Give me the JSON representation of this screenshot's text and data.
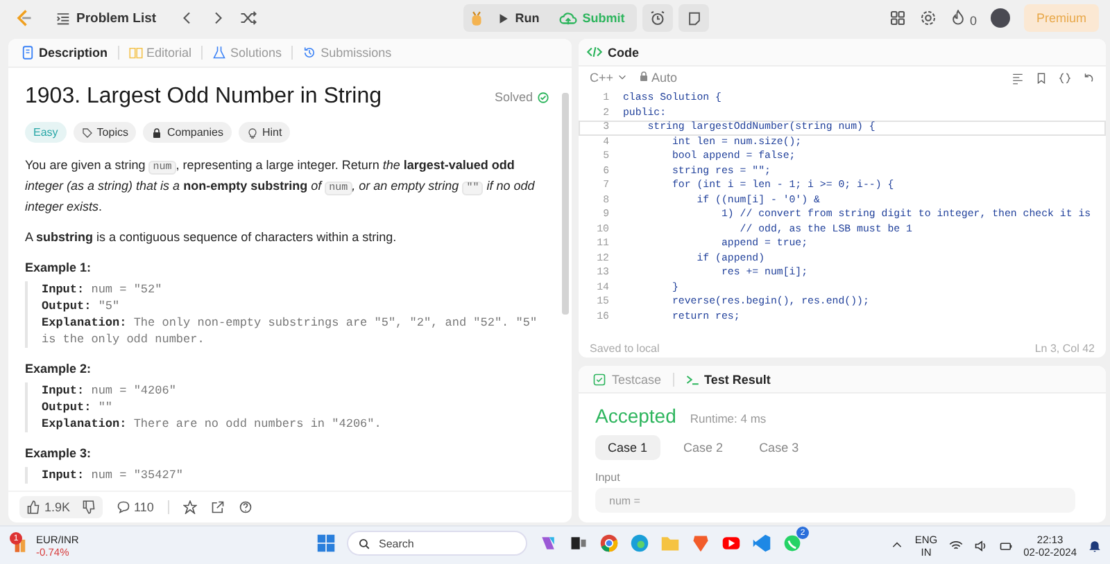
{
  "nav": {
    "problem_list": "Problem List",
    "run": "Run",
    "submit": "Submit",
    "streak": "0",
    "premium": "Premium"
  },
  "description_panel": {
    "tabs": [
      {
        "label": "Description",
        "selected": true
      },
      {
        "label": "Editorial",
        "selected": false
      },
      {
        "label": "Solutions",
        "selected": false
      },
      {
        "label": "Submissions",
        "selected": false
      }
    ],
    "title": "1903. Largest Odd Number in String",
    "status": "Solved",
    "tags": [
      {
        "kind": "difficulty",
        "label": "Easy"
      },
      {
        "kind": "topics",
        "label": "Topics"
      },
      {
        "kind": "companies",
        "label": "Companies"
      },
      {
        "kind": "hint",
        "label": "Hint"
      }
    ],
    "paragraphs": [
      [
        {
          "kind": "text",
          "text": "You are given a string "
        },
        {
          "kind": "code",
          "text": "num"
        },
        {
          "kind": "text",
          "text": ", representing a large integer. Return *the* **largest-valued odd** *integer (as a string) that is a* **non-empty substring** *of* "
        },
        {
          "kind": "code",
          "text": "num"
        },
        {
          "kind": "text",
          "text": "*, or an empty string* "
        },
        {
          "kind": "code",
          "text": "\"\""
        },
        {
          "kind": "text",
          "text": " *if no odd integer exists*."
        }
      ],
      [
        {
          "kind": "text",
          "text": "A **substring** is a contiguous sequence of characters within a string."
        }
      ]
    ],
    "examples": [
      {
        "heading": "Example 1:",
        "lines": [
          {
            "label": "Input:",
            "value": "num = \"52\""
          },
          {
            "label": "Output:",
            "value": "\"5\""
          },
          {
            "label": "Explanation:",
            "value": "The only non-empty substrings are \"5\", \"2\", and \"52\". \"5\" is the only odd number."
          }
        ]
      },
      {
        "heading": "Example 2:",
        "lines": [
          {
            "label": "Input:",
            "value": "num = \"4206\""
          },
          {
            "label": "Output:",
            "value": "\"\""
          },
          {
            "label": "Explanation:",
            "value": "There are no odd numbers in \"4206\"."
          }
        ]
      },
      {
        "heading": "Example 3:",
        "lines": [
          {
            "label": "Input:",
            "value": "num = \"35427\""
          }
        ]
      }
    ],
    "likes": "1.9K",
    "comments": "110"
  },
  "code_panel": {
    "title": "Code",
    "language": "C++",
    "mode": "Auto",
    "lines": [
      {
        "n": "1",
        "text": "class Solution {",
        "current": false
      },
      {
        "n": "2",
        "text": "public:",
        "current": false
      },
      {
        "n": "3",
        "text": "    string largestOddNumber(string num) {",
        "current": true
      },
      {
        "n": "4",
        "text": "        int len = num.size();",
        "current": false
      },
      {
        "n": "5",
        "text": "        bool append = false;",
        "current": false
      },
      {
        "n": "6",
        "text": "        string res = \"\";",
        "current": false
      },
      {
        "n": "7",
        "text": "        for (int i = len - 1; i >= 0; i--) {",
        "current": false
      },
      {
        "n": "8",
        "text": "            if ((num[i] - '0') &",
        "current": false
      },
      {
        "n": "9",
        "text": "                1) // convert from string digit to integer, then check it is",
        "current": false
      },
      {
        "n": "10",
        "text": "                   // odd, as the LSB must be 1",
        "current": false
      },
      {
        "n": "11",
        "text": "                append = true;",
        "current": false
      },
      {
        "n": "12",
        "text": "            if (append)",
        "current": false
      },
      {
        "n": "13",
        "text": "                res += num[i];",
        "current": false
      },
      {
        "n": "14",
        "text": "        }",
        "current": false
      },
      {
        "n": "15",
        "text": "        reverse(res.begin(), res.end());",
        "current": false
      },
      {
        "n": "16",
        "text": "        return res;",
        "current": false
      }
    ],
    "saved": "Saved to local",
    "cursor": "Ln 3, Col 42"
  },
  "result_panel": {
    "tabs": [
      {
        "label": "Testcase",
        "selected": false
      },
      {
        "label": "Test Result",
        "selected": true
      }
    ],
    "verdict": "Accepted",
    "runtime": "Runtime: 4 ms",
    "cases": [
      {
        "label": "Case 1",
        "selected": true
      },
      {
        "label": "Case 2",
        "selected": false
      },
      {
        "label": "Case 3",
        "selected": false
      }
    ],
    "input_label": "Input",
    "input_value": "num ="
  },
  "taskbar": {
    "ticker": {
      "badge": "1",
      "name": "EUR/INR",
      "change": "-0.74%"
    },
    "search": {
      "placeholder": "Search"
    },
    "chat_badge": "2",
    "language": "ENG",
    "region": "IN",
    "time": "22:13",
    "date": "02-02-2024"
  }
}
